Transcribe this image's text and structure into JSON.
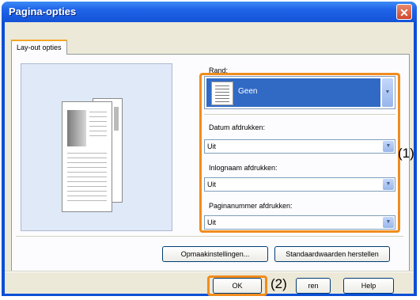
{
  "window": {
    "title": "Pagina-opties",
    "close_glyph": "✕"
  },
  "tab": {
    "label": "Lay-out opties"
  },
  "border": {
    "label": "Rand:",
    "value": "Geen"
  },
  "date": {
    "label": "Datum afdrukken:",
    "value": "Uit"
  },
  "login": {
    "label": "Inlognaam afdrukken:",
    "value": "Uit"
  },
  "pagenum": {
    "label": "Paginanummer afdrukken:",
    "value": "Uit"
  },
  "callouts": {
    "one": "(1)",
    "two": "(2)"
  },
  "buttons": {
    "format": "Opmaakinstellingen...",
    "defaults": "Standaardwaarden herstellen",
    "ok": "OK",
    "cancel": "ren",
    "help": "Help"
  },
  "icons": {
    "dropdown": "▼",
    "close": "close-icon"
  },
  "colors": {
    "titlebar": "#1f63e8",
    "selection": "#316ac5",
    "highlight": "#f08c1e",
    "dialog": "#ece9d8"
  }
}
